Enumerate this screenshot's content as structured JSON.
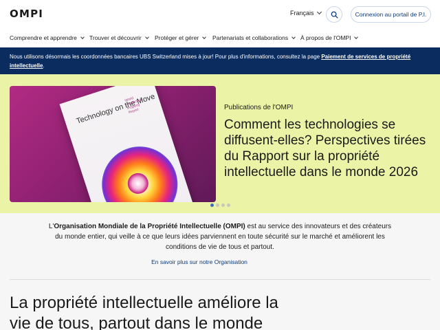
{
  "header": {
    "logo": "OMPI",
    "language": "Français",
    "login_label": "Connexion au portail de P.I."
  },
  "nav": {
    "items": [
      {
        "label": "Comprendre et apprendre"
      },
      {
        "label": "Trouver et découvrir"
      },
      {
        "label": "Protéger et gérer"
      },
      {
        "label": "Partenariats et collaborations"
      },
      {
        "label": "À propos de l'OMPI"
      }
    ]
  },
  "banner": {
    "text": "Nous utilisons désormais les coordonnées bancaires UBS Switzerland mises à jour! Pour plus d'informations, consultez la page ",
    "link": "Paiement de services de propriété intellectuelle",
    "suffix": "."
  },
  "hero": {
    "book_title": "Technology on the Move",
    "book_subtitle": "World Intellectual Property Report",
    "label": "Publications de l'OMPI",
    "title": "Comment les technologies se diffusent-elles? Perspectives tirées du Rapport sur la propriété intellectuelle dans le monde 2026",
    "slide_count": 4,
    "active_slide": 1,
    "colors": {
      "background": "#eaf3a6",
      "image": "#b12b83",
      "active_dot": "#3d6fb6"
    }
  },
  "about": {
    "prefix": "L'",
    "org_name": "Organisation Mondiale de la Propriété Intellectuelle (OMPI)",
    "text": " est au service des innovateurs et des créateurs du monde entier, qui veille à ce que leurs idées parviennent en toute sécurité sur le marché et améliorent les conditions de vie de tous et partout.",
    "link": "En savoir plus sur notre Organisation",
    "heading": "La propriété intellectuelle améliore la vie de tous, partout dans le monde"
  },
  "icons": {
    "search": "search-icon",
    "chevron": "chevron-down-icon"
  },
  "colors": {
    "banner": "#0b2c5f",
    "link": "#0b3a7a"
  }
}
